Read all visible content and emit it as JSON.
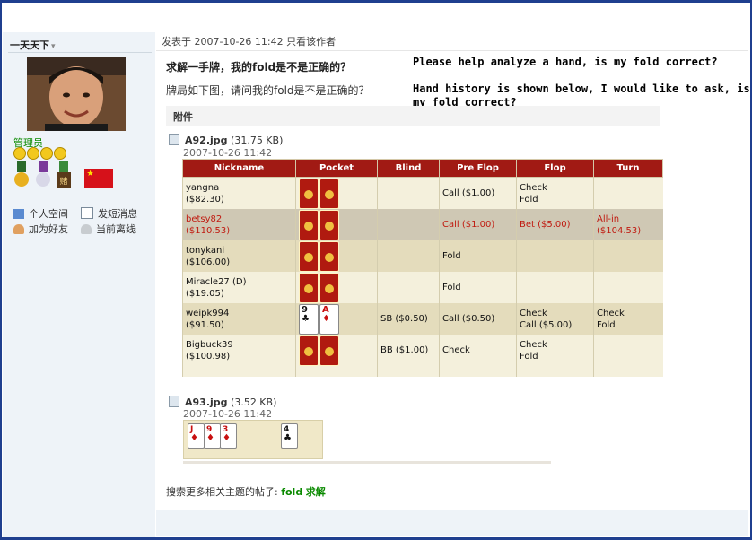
{
  "sidebar": {
    "username": "一天天下",
    "caret": "▾",
    "role": "管理员",
    "links": {
      "personal_space": "个人空间",
      "send_message": "发短消息",
      "add_friend": "加为好友",
      "status": "当前离线"
    }
  },
  "post": {
    "meta": "发表于  2007-10-26 11:42  只看该作者",
    "title": "求解一手牌，我的fold是不是正确的？",
    "body": "牌局如下图，请问我的fold是不是正确的？",
    "english_line1": "Please help analyze a hand, is my fold correct?",
    "english_line2": "Hand history is shown below, I would like to ask, is my fold correct?"
  },
  "attachments": {
    "label": "附件",
    "file1": {
      "name": "A92.jpg",
      "size": "(31.75 KB)",
      "date": "2007-10-26 11:42"
    },
    "file2": {
      "name": "A93.jpg",
      "size": "(3.52 KB)",
      "date": "2007-10-26 11:42"
    }
  },
  "hand_table": {
    "headers": [
      "Nickname",
      "Pocket",
      "Blind",
      "Pre Flop",
      "Flop",
      "Turn"
    ],
    "rows": [
      {
        "name": "yangna",
        "stack": "($82.30)",
        "blind": "",
        "preflop": "Call ($1.00)",
        "flop1": "Check",
        "flop2": "Fold",
        "turn1": "",
        "turn2": ""
      },
      {
        "name": "betsy82",
        "stack": "($110.53)",
        "blind": "",
        "preflop": "Call ($1.00)",
        "flop1": "Bet ($5.00)",
        "flop2": "",
        "turn1": "All-in ($104.53)",
        "turn2": ""
      },
      {
        "name": "tonykani",
        "stack": "($106.00)",
        "blind": "",
        "preflop": "Fold",
        "flop1": "",
        "flop2": "",
        "turn1": "",
        "turn2": ""
      },
      {
        "name": "Miracle27 (D)",
        "stack": "($19.05)",
        "blind": "",
        "preflop": "Fold",
        "flop1": "",
        "flop2": "",
        "turn1": "",
        "turn2": ""
      },
      {
        "name": "weipk994",
        "stack": "($91.50)",
        "blind": "SB ($0.50)",
        "preflop": "Call ($0.50)",
        "flop1": "Check",
        "flop2": "Call ($5.00)",
        "turn1": "Check",
        "turn2": "Fold"
      },
      {
        "name": "Bigbuck39",
        "stack": "($100.98)",
        "blind": "BB ($1.00)",
        "preflop": "Check",
        "flop1": "Check",
        "flop2": "Fold",
        "turn1": "",
        "turn2": ""
      }
    ],
    "hero_cards": [
      {
        "rank": "9",
        "suit": "♣"
      },
      {
        "rank": "A",
        "suit": "♦"
      }
    ]
  },
  "board_cards": [
    {
      "rank": "J",
      "suit": "♦"
    },
    {
      "rank": "9",
      "suit": "♦"
    },
    {
      "rank": "3",
      "suit": "♦"
    },
    {
      "rank": "4",
      "suit": "♣"
    }
  ],
  "search": {
    "prefix": "搜索更多相关主题的帖子:",
    "kw1": "fold",
    "kw2": "求解"
  },
  "colors": {
    "accent": "#a11a14",
    "frame": "#1f3f8f",
    "green": "#0a8a00",
    "highlight_text": "#c01a10"
  }
}
